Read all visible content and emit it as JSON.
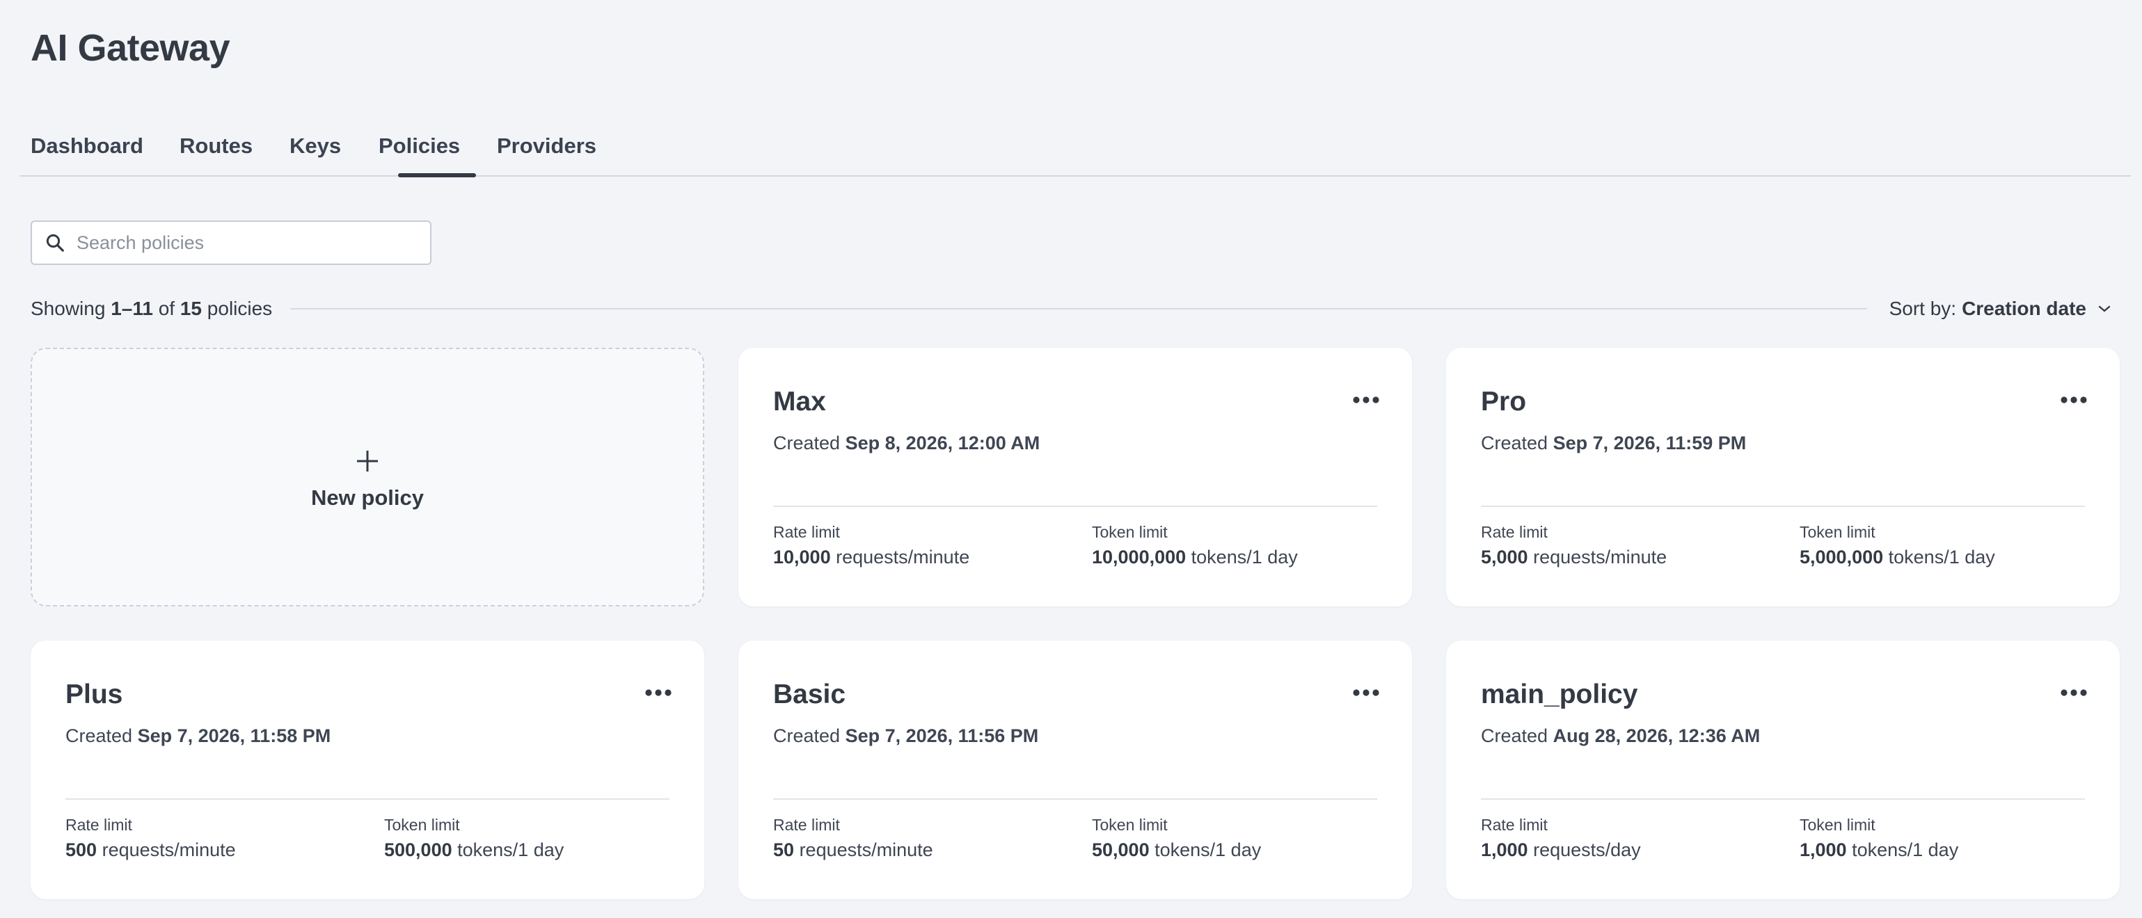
{
  "app": {
    "title": "AI Gateway"
  },
  "tabs": [
    {
      "label": "Dashboard",
      "active": false
    },
    {
      "label": "Routes",
      "active": false
    },
    {
      "label": "Keys",
      "active": false
    },
    {
      "label": "Policies",
      "active": true
    },
    {
      "label": "Providers",
      "active": false
    }
  ],
  "search": {
    "placeholder": "Search policies",
    "value": ""
  },
  "results": {
    "prefix": "Showing",
    "range": "1–11",
    "of": "of",
    "total": "15",
    "suffix": "policies"
  },
  "sort": {
    "label": "Sort by:",
    "value": "Creation date"
  },
  "new_policy": {
    "label": "New policy"
  },
  "policy_labels": {
    "created": "Created",
    "rate_limit": "Rate limit",
    "token_limit": "Token limit"
  },
  "policies": [
    {
      "name": "Max",
      "created": "Sep 8, 2026, 12:00 AM",
      "rate_value": "10,000",
      "rate_unit": "requests/minute",
      "token_value": "10,000,000",
      "token_unit": "tokens/1 day"
    },
    {
      "name": "Pro",
      "created": "Sep 7, 2026, 11:59 PM",
      "rate_value": "5,000",
      "rate_unit": "requests/minute",
      "token_value": "5,000,000",
      "token_unit": "tokens/1 day"
    },
    {
      "name": "Plus",
      "created": "Sep 7, 2026, 11:58 PM",
      "rate_value": "500",
      "rate_unit": "requests/minute",
      "token_value": "500,000",
      "token_unit": "tokens/1 day"
    },
    {
      "name": "Basic",
      "created": "Sep 7, 2026, 11:56 PM",
      "rate_value": "50",
      "rate_unit": "requests/minute",
      "token_value": "50,000",
      "token_unit": "tokens/1 day"
    },
    {
      "name": "main_policy",
      "created": "Aug 28, 2026, 12:36 AM",
      "rate_value": "1,000",
      "rate_unit": "requests/day",
      "token_value": "1,000",
      "token_unit": "tokens/1 day"
    }
  ],
  "icons": {
    "search": "search-icon",
    "plus": "plus-icon",
    "more": "more-horizontal-icon",
    "sort_chevron": "chevron-down-icon"
  },
  "colors": {
    "background": "#f2f4f8",
    "text": "#343a44",
    "card": "#ffffff",
    "active_tab_indicator": "#343a44"
  }
}
